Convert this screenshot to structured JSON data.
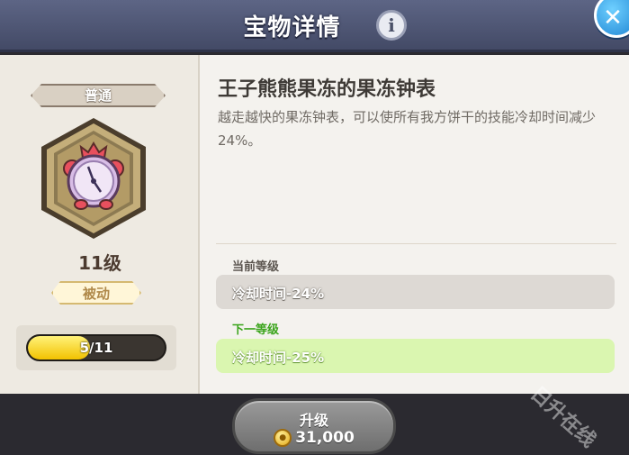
{
  "header": {
    "title": "宝物详情",
    "info_icon": "info-icon",
    "close_icon": "close-icon"
  },
  "item": {
    "rarity": "普通",
    "level": "11级",
    "type": "被动",
    "progress": {
      "label": "5/11",
      "current": 5,
      "max": 11
    },
    "name": "王子熊熊果冻的果冻钟表",
    "description": "越走越快的果冻钟表，可以使所有我方饼干的技能冷却时间减少 24%。",
    "icon": "jelly-clock-icon"
  },
  "current_level": {
    "label": "当前等级",
    "effect": "冷却时间-24%"
  },
  "next_level": {
    "label": "下一等级",
    "effect": "冷却时间-25%"
  },
  "upgrade": {
    "label": "升级",
    "cost": "31,000",
    "currency_icon": "coin-icon"
  },
  "watermark": "日升在线",
  "colors": {
    "header": "#4b5270",
    "close_button": "#2a9ae8",
    "progress_fill": "#f5cd0a",
    "next_level_bg": "#daf6b0",
    "next_level_label": "#3aa41b"
  }
}
